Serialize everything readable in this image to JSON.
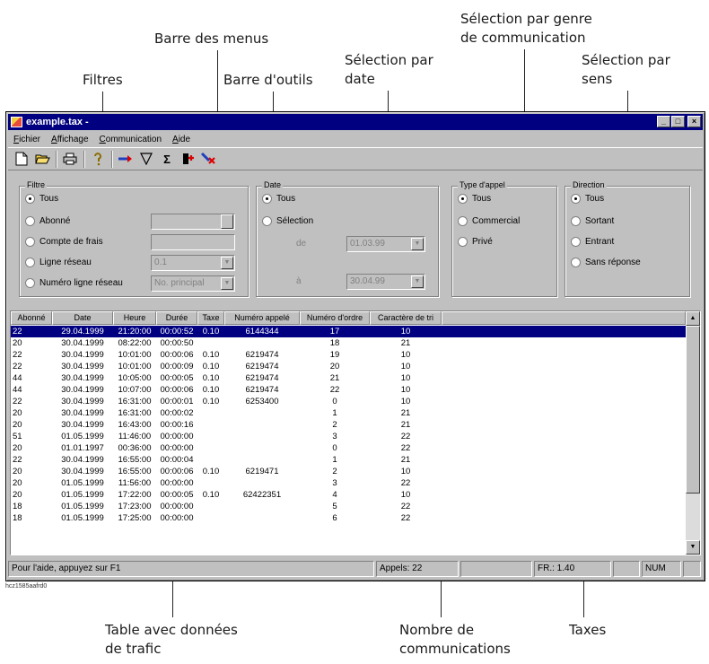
{
  "annotations": {
    "menus": "Barre des menus",
    "filters": "Filtres",
    "toolbar": "Barre d'outils",
    "date_sel_1": "Sélection par",
    "date_sel_2": "date",
    "type_sel_1": "Sélection par genre",
    "type_sel_2": "de communication",
    "dir_sel_1": "Sélection par",
    "dir_sel_2": "sens",
    "table_1": "Table avec données",
    "table_2": "de trafic",
    "count_1": "Nombre de",
    "count_2": "communications",
    "taxes": "Taxes"
  },
  "image_id": "hcz1585aafrd0",
  "window": {
    "title": "example.tax -",
    "minimize": "_",
    "maximize": "□",
    "close": "×"
  },
  "menu": [
    "Fichier",
    "Affichage",
    "Communication",
    "Aide"
  ],
  "toolbar_icons": [
    "new-document-icon",
    "open-folder-icon",
    "printer-icon",
    "help-icon",
    "import-icon",
    "filter-icon",
    "sum-icon",
    "delete-icon",
    "clear-icon"
  ],
  "filter": {
    "label": "Filtre",
    "options": [
      "Tous",
      "Abonné",
      "Compte de frais",
      "Ligne réseau",
      "Numéro ligne réseau"
    ],
    "ligne_reseau_value": "0.1",
    "numero_ligne_value": "No. principal"
  },
  "date": {
    "label": "Date",
    "options": [
      "Tous",
      "Sélection"
    ],
    "de_label": "de",
    "a_label": "à",
    "de_value": "01.03.99",
    "a_value": "30.04.99"
  },
  "call_type": {
    "label": "Type d'appel",
    "options": [
      "Tous",
      "Commercial",
      "Privé"
    ]
  },
  "direction": {
    "label": "Direction",
    "options": [
      "Tous",
      "Sortant",
      "Entrant",
      "Sans réponse"
    ]
  },
  "table": {
    "headers": [
      "Abonné",
      "Date",
      "Heure",
      "Durée",
      "Taxe",
      "Numéro appelé",
      "Numéro d'ordre",
      "Caractère de tri"
    ],
    "rows": [
      [
        "22",
        "29.04.1999",
        "21:20:00",
        "00:00:52",
        "0.10",
        "6144344",
        "17",
        "10"
      ],
      [
        "20",
        "30.04.1999",
        "08:22:00",
        "00:00:50",
        "",
        "",
        "18",
        "21"
      ],
      [
        "22",
        "30.04.1999",
        "10:01:00",
        "00:00:06",
        "0.10",
        "6219474",
        "19",
        "10"
      ],
      [
        "22",
        "30.04.1999",
        "10:01:00",
        "00:00:09",
        "0.10",
        "6219474",
        "20",
        "10"
      ],
      [
        "44",
        "30.04.1999",
        "10:05:00",
        "00:00:05",
        "0.10",
        "6219474",
        "21",
        "10"
      ],
      [
        "44",
        "30.04.1999",
        "10:07:00",
        "00:00:06",
        "0.10",
        "6219474",
        "22",
        "10"
      ],
      [
        "22",
        "30.04.1999",
        "16:31:00",
        "00:00:01",
        "0.10",
        "6253400",
        "0",
        "10"
      ],
      [
        "20",
        "30.04.1999",
        "16:31:00",
        "00:00:02",
        "",
        "",
        "1",
        "21"
      ],
      [
        "20",
        "30.04.1999",
        "16:43:00",
        "00:00:16",
        "",
        "",
        "2",
        "21"
      ],
      [
        "51",
        "01.05.1999",
        "11:46:00",
        "00:00:00",
        "",
        "",
        "3",
        "22"
      ],
      [
        "20",
        "01.01.1997",
        "00:36:00",
        "00:00:00",
        "",
        "",
        "0",
        "22"
      ],
      [
        "22",
        "30.04.1999",
        "16:55:00",
        "00:00:04",
        "",
        "",
        "1",
        "21"
      ],
      [
        "20",
        "30.04.1999",
        "16:55:00",
        "00:00:06",
        "0.10",
        "6219471",
        "2",
        "10"
      ],
      [
        "20",
        "01.05.1999",
        "11:56:00",
        "00:00:00",
        "",
        "",
        "3",
        "22"
      ],
      [
        "20",
        "01.05.1999",
        "17:22:00",
        "00:00:05",
        "0.10",
        "62422351",
        "4",
        "10"
      ],
      [
        "18",
        "01.05.1999",
        "17:23:00",
        "00:00:00",
        "",
        "",
        "5",
        "22"
      ],
      [
        "18",
        "01.05.1999",
        "17:25:00",
        "00:00:00",
        "",
        "",
        "6",
        "22"
      ]
    ]
  },
  "status": {
    "help": "Pour l'aide, appuyez sur F1",
    "calls": "Appels: 22",
    "taxes": "FR.: 1.40",
    "num": "NUM"
  }
}
